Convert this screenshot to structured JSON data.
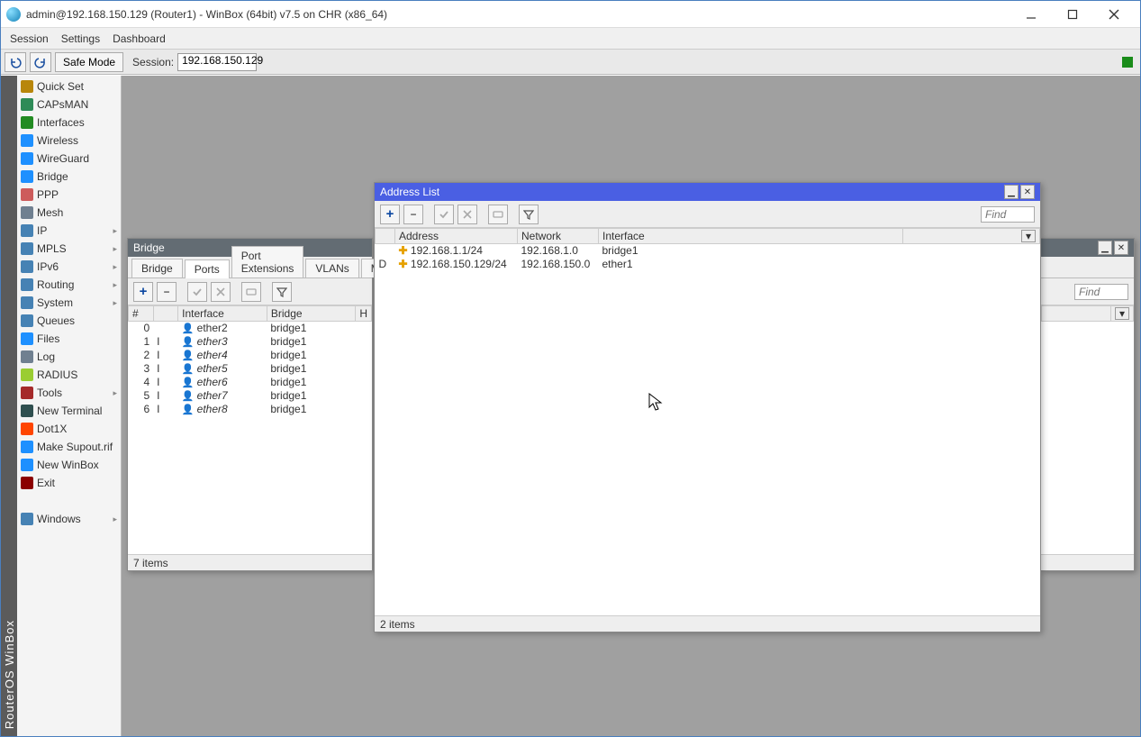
{
  "title": "admin@192.168.150.129 (Router1) - WinBox (64bit) v7.5 on CHR (x86_64)",
  "menu": {
    "session": "Session",
    "settings": "Settings",
    "dashboard": "Dashboard"
  },
  "sessionbar": {
    "safe_mode": "Safe Mode",
    "session_label": "Session:",
    "session_ip": "192.168.150.129"
  },
  "vstrip": "RouterOS WinBox",
  "sidebar": [
    {
      "icon": "#b8860b",
      "label": "Quick Set",
      "chev": false
    },
    {
      "icon": "#2e8b57",
      "label": "CAPsMAN",
      "chev": false
    },
    {
      "icon": "#228b22",
      "label": "Interfaces",
      "chev": false
    },
    {
      "icon": "#1e90ff",
      "label": "Wireless",
      "chev": false
    },
    {
      "icon": "#1e90ff",
      "label": "WireGuard",
      "chev": false
    },
    {
      "icon": "#1e90ff",
      "label": "Bridge",
      "chev": false
    },
    {
      "icon": "#cd5c5c",
      "label": "PPP",
      "chev": false
    },
    {
      "icon": "#708090",
      "label": "Mesh",
      "chev": false
    },
    {
      "icon": "#4682b4",
      "label": "IP",
      "chev": true
    },
    {
      "icon": "#4682b4",
      "label": "MPLS",
      "chev": true
    },
    {
      "icon": "#4682b4",
      "label": "IPv6",
      "chev": true
    },
    {
      "icon": "#4682b4",
      "label": "Routing",
      "chev": true
    },
    {
      "icon": "#4682b4",
      "label": "System",
      "chev": true
    },
    {
      "icon": "#4682b4",
      "label": "Queues",
      "chev": false
    },
    {
      "icon": "#1e90ff",
      "label": "Files",
      "chev": false
    },
    {
      "icon": "#708090",
      "label": "Log",
      "chev": false
    },
    {
      "icon": "#9acd32",
      "label": "RADIUS",
      "chev": false
    },
    {
      "icon": "#a52a2a",
      "label": "Tools",
      "chev": true
    },
    {
      "icon": "#2f4f4f",
      "label": "New Terminal",
      "chev": false
    },
    {
      "icon": "#ff4500",
      "label": "Dot1X",
      "chev": false
    },
    {
      "icon": "#1e90ff",
      "label": "Make Supout.rif",
      "chev": false
    },
    {
      "icon": "#1e90ff",
      "label": "New WinBox",
      "chev": false
    },
    {
      "icon": "#8b0000",
      "label": "Exit",
      "chev": false
    },
    {
      "spacer": true
    },
    {
      "icon": "#4682b4",
      "label": "Windows",
      "chev": true
    }
  ],
  "find_placeholder": "Find",
  "bridge_window": {
    "title": "Bridge",
    "tabs": [
      "Bridge",
      "Ports",
      "Port Extensions",
      "VLANs",
      "MSTIs"
    ],
    "active_tab": 1,
    "columns": [
      "#",
      "",
      "Interface",
      "Bridge",
      "H"
    ],
    "rows": [
      {
        "n": "0",
        "f": "",
        "iface": "ether2",
        "bridge": "bridge1",
        "italic": false
      },
      {
        "n": "1",
        "f": "I",
        "iface": "ether3",
        "bridge": "bridge1",
        "italic": true
      },
      {
        "n": "2",
        "f": "I",
        "iface": "ether4",
        "bridge": "bridge1",
        "italic": true
      },
      {
        "n": "3",
        "f": "I",
        "iface": "ether5",
        "bridge": "bridge1",
        "italic": true
      },
      {
        "n": "4",
        "f": "I",
        "iface": "ether6",
        "bridge": "bridge1",
        "italic": true
      },
      {
        "n": "5",
        "f": "I",
        "iface": "ether7",
        "bridge": "bridge1",
        "italic": true
      },
      {
        "n": "6",
        "f": "I",
        "iface": "ether8",
        "bridge": "bridge1",
        "italic": true
      }
    ],
    "status": "7 items"
  },
  "address_window": {
    "title": "Address List",
    "columns": [
      "",
      "Address",
      "Network",
      "Interface"
    ],
    "rows": [
      {
        "flag": "",
        "addr": "192.168.1.1/24",
        "net": "192.168.1.0",
        "iface": "bridge1"
      },
      {
        "flag": "D",
        "addr": "192.168.150.129/24",
        "net": "192.168.150.0",
        "iface": "ether1"
      }
    ],
    "status": "2 items"
  }
}
